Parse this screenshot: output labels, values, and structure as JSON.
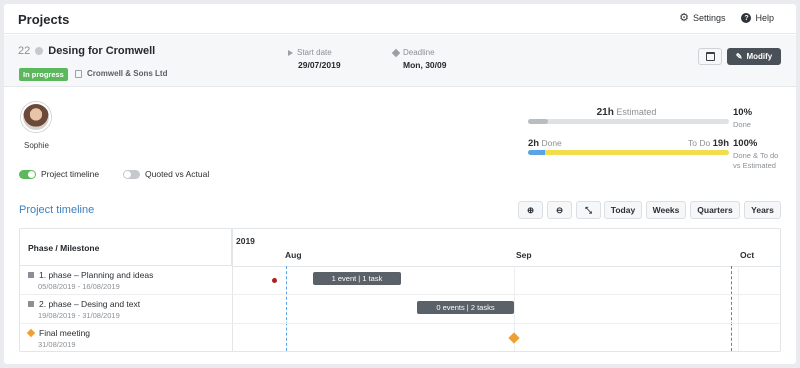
{
  "app": {
    "title": "Projects",
    "settings_label": "Settings",
    "help_label": "Help"
  },
  "project": {
    "number": "22",
    "name": "Desing for Cromwell",
    "status": "In progress",
    "company": "Cromwell & Sons Ltd",
    "start_label": "Start date",
    "start_value": "29/07/2019",
    "deadline_label": "Deadline",
    "deadline_value": "Mon, 30/09",
    "modify_label": "Modify"
  },
  "user": {
    "name": "Sophie"
  },
  "toggles": {
    "project_timeline": "Project timeline",
    "quoted_vs_actual": "Quoted vs Actual",
    "project_timeline_on": true,
    "quoted_vs_actual_on": false
  },
  "stats": {
    "estimated_value": "21h",
    "estimated_label": "Estimated",
    "estimated_done_pct": "10%",
    "estimated_done_label": "Done",
    "done_value": "2h",
    "done_label": "Done",
    "todo_label": "To Do",
    "todo_value": "19h",
    "combined_pct": "100%",
    "combined_label_1": "Done & To do",
    "combined_label_2": "vs Estimated",
    "estimated_progress": 0.1,
    "done_progress": 0.095
  },
  "timeline": {
    "title": "Project timeline",
    "buttons": {
      "today": "Today",
      "weeks": "Weeks",
      "quarters": "Quarters",
      "years": "Years"
    },
    "column_header": "Phase / Milestone",
    "year": "2019",
    "months": [
      "Aug",
      "Sep",
      "Oct"
    ],
    "rows": [
      {
        "name": "1. phase – Planning and ideas",
        "dates": "05/08/2019 - 16/08/2019",
        "bar_label": "1 event | 1 task"
      },
      {
        "name": "2. phase – Desing and text",
        "dates": "19/08/2019 - 31/08/2019",
        "bar_label": "0 events | 2 tasks"
      },
      {
        "name": "Final meeting",
        "dates": "31/08/2019"
      }
    ]
  },
  "colors": {
    "accent": "#3d7fbf",
    "status_green": "#5cb85c",
    "done_blue": "#5aa3e6",
    "todo_yellow": "#f2dd4f",
    "milestone_orange": "#f0a030",
    "deadline_red": "#d25a4a"
  }
}
